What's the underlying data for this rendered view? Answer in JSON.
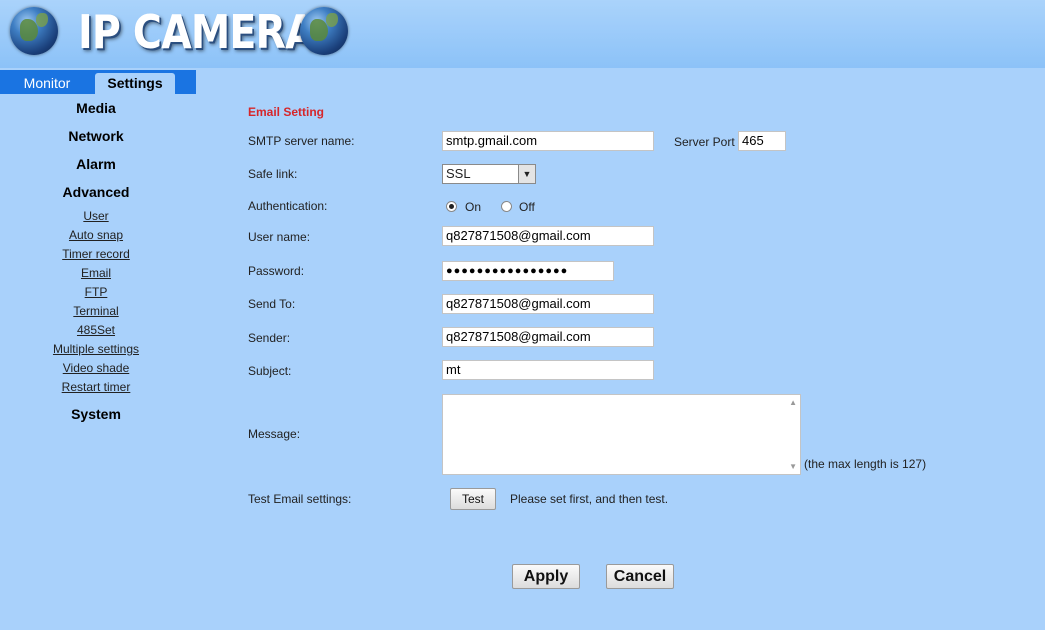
{
  "header": {
    "logo_text": "IP CAMERA"
  },
  "tabs": {
    "monitor": "Monitor",
    "settings": "Settings"
  },
  "sidebar": {
    "media": "Media",
    "network": "Network",
    "alarm": "Alarm",
    "advanced": "Advanced",
    "advanced_items": [
      "User",
      "Auto snap",
      "Timer record",
      "Email",
      "FTP",
      "Terminal",
      "485Set",
      "Multiple settings",
      "Video shade",
      "Restart timer"
    ],
    "system": "System"
  },
  "form": {
    "section_title": "Email Setting",
    "smtp_label": "SMTP server name:",
    "smtp_value": "smtp.gmail.com",
    "port_label": "Server Port",
    "port_value": "465",
    "safe_link_label": "Safe link:",
    "safe_link_value": "SSL",
    "auth_label": "Authentication:",
    "auth_on": "On",
    "auth_off": "Off",
    "auth_selected": "On",
    "user_label": "User name:",
    "user_value": "q827871508@gmail.com",
    "password_label": "Password:",
    "password_value": "●●●●●●●●●●●●●●●●",
    "send_to_label": "Send To:",
    "send_to_value": "q827871508@gmail.com",
    "sender_label": "Sender:",
    "sender_value": "q827871508@gmail.com",
    "subject_label": "Subject:",
    "subject_value": "mt",
    "message_label": "Message:",
    "message_note": "(the max length is 127)",
    "test_label": "Test Email settings:",
    "test_button": "Test",
    "test_note": "Please set first, and then test."
  },
  "actions": {
    "apply": "Apply",
    "cancel": "Cancel"
  }
}
